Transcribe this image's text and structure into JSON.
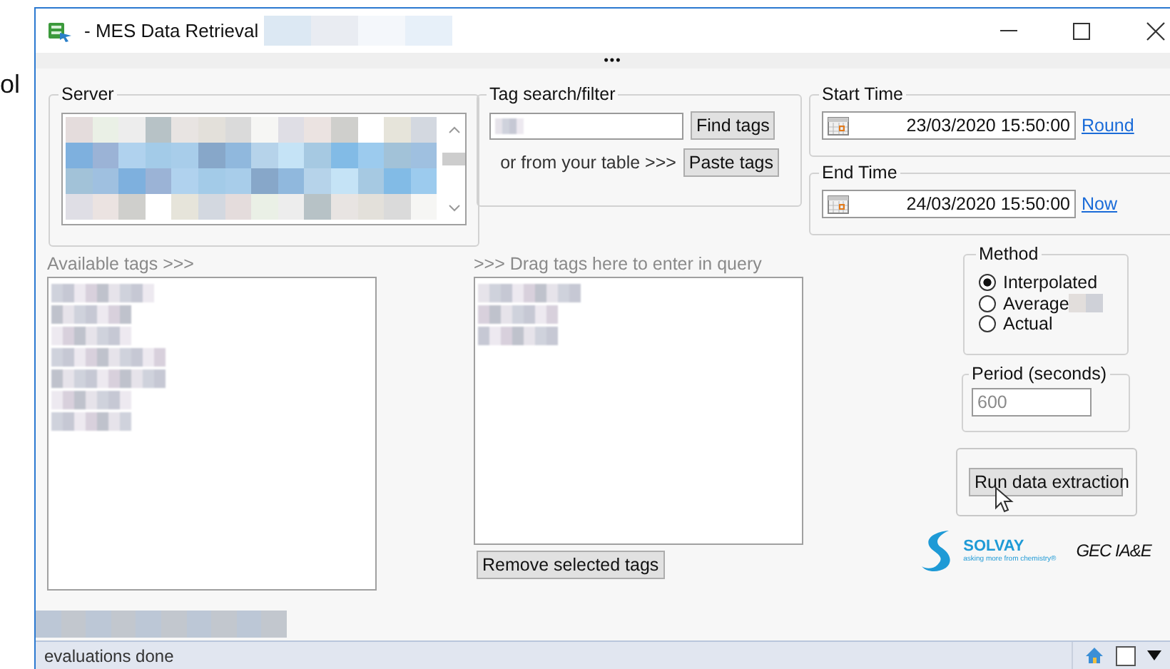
{
  "background_text": "ol",
  "window": {
    "title": "- MES Data Retrieval",
    "title_redacted": true
  },
  "toolbar_handle": "•••",
  "server": {
    "label": "Server",
    "rows": [
      {
        "selected": false
      },
      {
        "selected": true
      },
      {
        "selected": true
      },
      {
        "selected": false
      }
    ]
  },
  "tag_search": {
    "label": "Tag search/filter",
    "field_redacted": true,
    "find_button": "Find tags",
    "table_hint": "or from your table >>>",
    "paste_button": "Paste tags"
  },
  "start_time": {
    "label": "Start Time",
    "value": "23/03/2020 15:50:00",
    "link": "Round"
  },
  "end_time": {
    "label": "End Time",
    "value": "24/03/2020 15:50:00",
    "link": "Now"
  },
  "available_tags": {
    "label": "Available tags >>>",
    "items": [
      {
        "redacted": true
      },
      {
        "redacted": true
      },
      {
        "redacted": true
      },
      {
        "redacted": true
      },
      {
        "redacted": true
      },
      {
        "redacted": true
      },
      {
        "redacted": true
      }
    ]
  },
  "query_tags": {
    "label": ">>> Drag tags here to enter in query",
    "items": [
      {
        "redacted": true
      },
      {
        "redacted": true
      },
      {
        "redacted": true
      }
    ],
    "remove_button": "Remove selected tags"
  },
  "method": {
    "label": "Method",
    "options": [
      {
        "label": "Interpolated",
        "selected": true,
        "redacted": false
      },
      {
        "label": "Average",
        "selected": false,
        "redacted": true
      },
      {
        "label": "Actual",
        "selected": false,
        "redacted": false
      }
    ]
  },
  "period": {
    "label": "Period (seconds)",
    "value": "600",
    "disabled": true
  },
  "run_button": "Run data extraction",
  "logo": {
    "brand": "SOLVAY",
    "tagline": "asking more from chemistry®",
    "team": "GEC IA&E"
  },
  "footer_strip": {
    "redacted": true
  },
  "status_bar": {
    "text": "evaluations done"
  }
}
